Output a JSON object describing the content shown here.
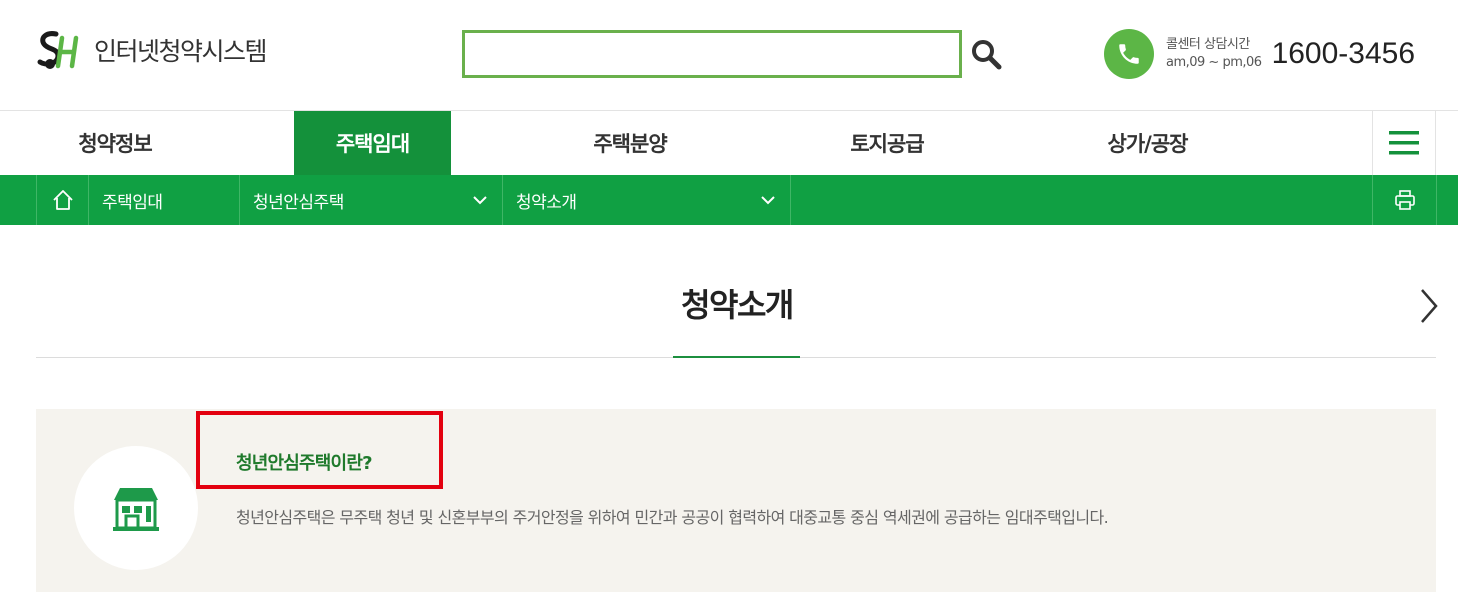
{
  "header": {
    "logo_text": "인터넷청약시스템",
    "search_placeholder": "",
    "call_label": "콜센터 상담시간",
    "call_hours": "am,09 ~ pm,06",
    "call_number": "1600-3456"
  },
  "gnb": {
    "items": [
      {
        "label": "청약정보"
      },
      {
        "label": "주택임대"
      },
      {
        "label": "주택분양"
      },
      {
        "label": "토지공급"
      },
      {
        "label": "상가/공장"
      }
    ],
    "active_index": 1
  },
  "breadcrumb": {
    "level1": "주택임대",
    "level2": "청년안심주택",
    "level3": "청약소개"
  },
  "page": {
    "title": "청약소개"
  },
  "info": {
    "heading": "청년안심주택이란?",
    "description": "청년안심주택은 무주택 청년 및 신혼부부의 주거안정을 위하여 민간과 공공이 협력하여 대중교통 중심 역세권에 공급하는 임대주택입니다."
  },
  "colors": {
    "brand_green": "#14913b",
    "breadcrumb_green": "#10a043",
    "search_border": "#6ab04c",
    "highlight_red": "#e3000f"
  },
  "icons": [
    "sh-logo",
    "search-icon",
    "phone-icon",
    "hamburger-menu-icon",
    "home-icon",
    "chevron-down-icon",
    "print-icon",
    "chevron-right-icon",
    "house-icon"
  ]
}
